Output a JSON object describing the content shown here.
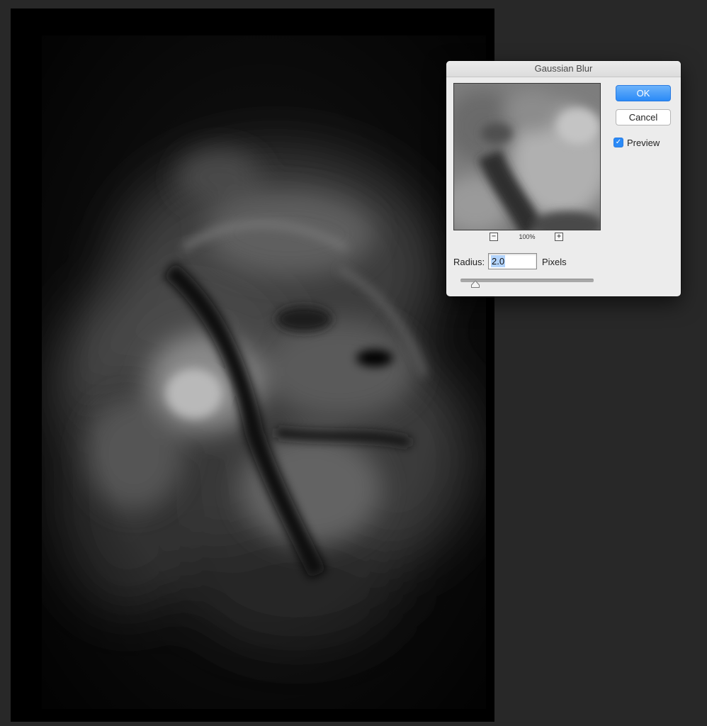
{
  "dialog": {
    "title": "Gaussian Blur",
    "ok_label": "OK",
    "cancel_label": "Cancel",
    "preview_label": "Preview",
    "preview_checked": true,
    "zoom_out_symbol": "−",
    "zoom_in_symbol": "+",
    "zoom_level": "100%",
    "radius_label": "Radius:",
    "radius_value": "2.0",
    "radius_unit": "Pixels",
    "radius_slider_fraction": 0.11
  },
  "icons": {
    "checkmark": "✓",
    "zoom_out": "minus-icon",
    "zoom_in": "plus-icon"
  },
  "colors": {
    "workspace_bg": "#282828",
    "accent_blue": "#2a8af7",
    "dialog_bg": "#ececec"
  }
}
